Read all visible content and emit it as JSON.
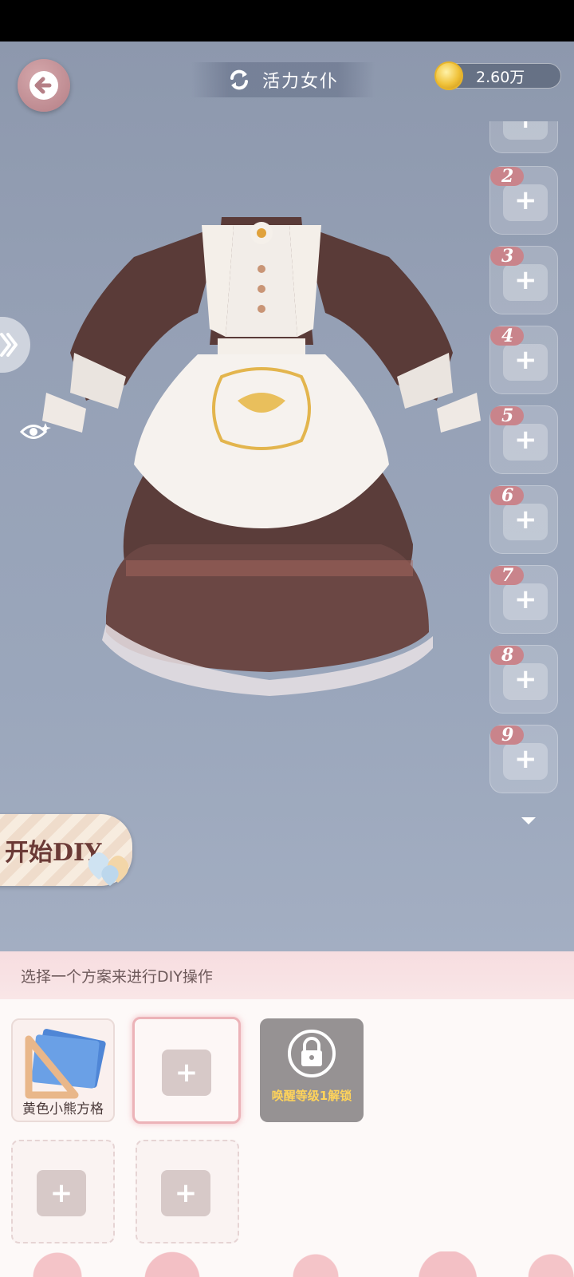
{
  "header": {
    "title": "活力女仆",
    "coins": "2.60万"
  },
  "icons": {
    "back": "back-arrow-icon",
    "refresh": "refresh-icon",
    "coin": "coin-icon",
    "expand": "chevron-right-icon",
    "eye": "eye-icon",
    "scroll_down": "triangle-down-icon",
    "lock": "lock-icon",
    "add": "add-icon"
  },
  "slots": [
    {
      "number": ""
    },
    {
      "number": "2"
    },
    {
      "number": "3"
    },
    {
      "number": "4"
    },
    {
      "number": "5"
    },
    {
      "number": "6"
    },
    {
      "number": "7"
    },
    {
      "number": "8"
    },
    {
      "number": "9"
    }
  ],
  "diy": {
    "start_label": "开始DIY"
  },
  "panel": {
    "instruction": "选择一个方案来进行DIY操作",
    "schemes": [
      {
        "label": "黄色小熊方格",
        "state": "filled"
      },
      {
        "label": "",
        "state": "selected-empty"
      },
      {
        "label": "唤醒等级1解锁",
        "state": "locked"
      },
      {
        "label": "",
        "state": "empty"
      },
      {
        "label": "",
        "state": "empty"
      }
    ]
  },
  "colors": {
    "accent_pink": "#ecb3b8",
    "slot_badge": "#c9848b",
    "lock_text": "#ffd35a",
    "coin": "#f0c23a"
  }
}
